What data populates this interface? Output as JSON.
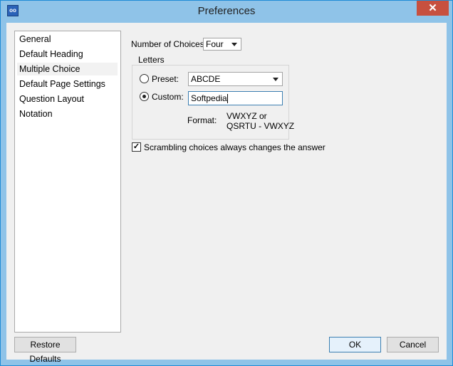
{
  "window": {
    "title": "Preferences",
    "close_glyph": "✕",
    "app_icon": "app-icon"
  },
  "sidebar": {
    "items": [
      {
        "label": "General"
      },
      {
        "label": "Default Heading"
      },
      {
        "label": "Multiple Choice",
        "selected": true
      },
      {
        "label": "Default Page Settings"
      },
      {
        "label": "Question Layout"
      },
      {
        "label": "Notation"
      }
    ]
  },
  "main": {
    "num_choices_label": "Number of Choices:",
    "num_choices_value": "Four",
    "letters_group_title": "Letters",
    "preset_label": "Preset:",
    "preset_value": "ABCDE",
    "custom_label": "Custom:",
    "custom_value": "Softpedia",
    "selected_option": "custom",
    "format_label": "Format:",
    "format_example_1": "VWXYZ  or",
    "format_example_2": "QSRTU - VWXYZ",
    "scramble_label": "Scrambling choices always changes the answer",
    "scramble_checked": true,
    "check_glyph": "✓"
  },
  "footer": {
    "restore_label": "Restore Defaults",
    "ok_label": "OK",
    "cancel_label": "Cancel"
  }
}
